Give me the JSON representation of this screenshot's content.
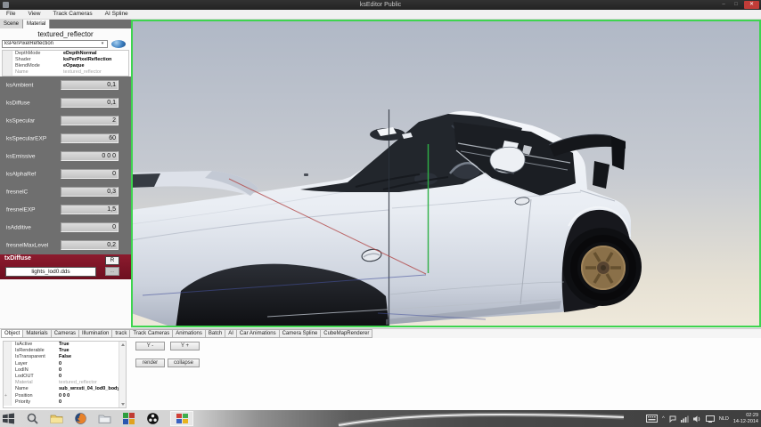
{
  "colors": {
    "viewport_border_green": "#3ed44f",
    "texture_header_red": "#7d1426",
    "slider_panel_gray": "#6f6f6f",
    "titlebar_dark": "#2a2a2a",
    "close_button_red": "#c13c38",
    "wheel_bronze": "#8a7049"
  },
  "window": {
    "title": "ksEditor Public",
    "controls": {
      "minimize": "–",
      "maximize": "□",
      "close": "✕"
    }
  },
  "menubar": {
    "items": [
      "File",
      "View",
      "Track Cameras",
      "AI Spline"
    ]
  },
  "material_panel": {
    "tabs": [
      {
        "label": "Scene"
      },
      {
        "label": "Material"
      }
    ],
    "title": "textured_reflector",
    "shader_select": {
      "value": "ksPerPixelReflection",
      "arrow": "▾"
    },
    "info": [
      {
        "label": "DepthMode",
        "value": "eDepthNormal"
      },
      {
        "label": "Shader",
        "value": "ksPerPixelReflection"
      },
      {
        "label": "BlendMode",
        "value": "eOpaque"
      },
      {
        "label": "Name",
        "value": "textured_reflector"
      }
    ],
    "sliders": [
      {
        "label": "ksAmbient",
        "value": "0,1"
      },
      {
        "label": "ksDiffuse",
        "value": "0,1"
      },
      {
        "label": "ksSpecular",
        "value": "2"
      },
      {
        "label": "ksSpecularEXP",
        "value": "60"
      },
      {
        "label": "ksEmissive",
        "value": "0 0 0"
      },
      {
        "label": "ksAlphaRef",
        "value": "0"
      },
      {
        "label": "fresnelC",
        "value": "0,3"
      },
      {
        "label": "fresnelEXP",
        "value": "1,5"
      },
      {
        "label": "isAdditive",
        "value": "0"
      },
      {
        "label": "fresnelMaxLevel",
        "value": "0,2"
      }
    ],
    "texture_slot": {
      "name": "txDiffuse",
      "refresh_label": "R",
      "file": "lights_lod0.dds",
      "browse_label": "..."
    }
  },
  "bottom_tabs": [
    "Object",
    "Materials",
    "Cameras",
    "Illumination",
    "track",
    "Track Cameras",
    "Animations",
    "Batch",
    "AI",
    "Car Animations",
    "Camera Spline",
    "CubeMapRenderer"
  ],
  "object_panel": {
    "properties": [
      {
        "label": "IsActive",
        "value": "True"
      },
      {
        "label": "IsRenderable",
        "value": "True"
      },
      {
        "label": "IsTransparent",
        "value": "False"
      },
      {
        "label": "Layer",
        "value": "0"
      },
      {
        "label": "LodIN",
        "value": "0"
      },
      {
        "label": "LodOUT",
        "value": "0"
      },
      {
        "label": "Material",
        "value": "textured_reflector"
      },
      {
        "label": "Name",
        "value": "sub_wrxsti_04_lod0_body"
      },
      {
        "label": "Position",
        "value": "0 0 0"
      },
      {
        "label": "Priority",
        "value": "0"
      }
    ],
    "buttons": {
      "y_minus": "Y -",
      "y_plus": "Y +",
      "render": "render",
      "collapse": "collapse"
    }
  },
  "taskbar": {
    "tray": {
      "language": "NLD",
      "time": "02:29",
      "date": "14-12-2014",
      "caret": "^"
    }
  }
}
